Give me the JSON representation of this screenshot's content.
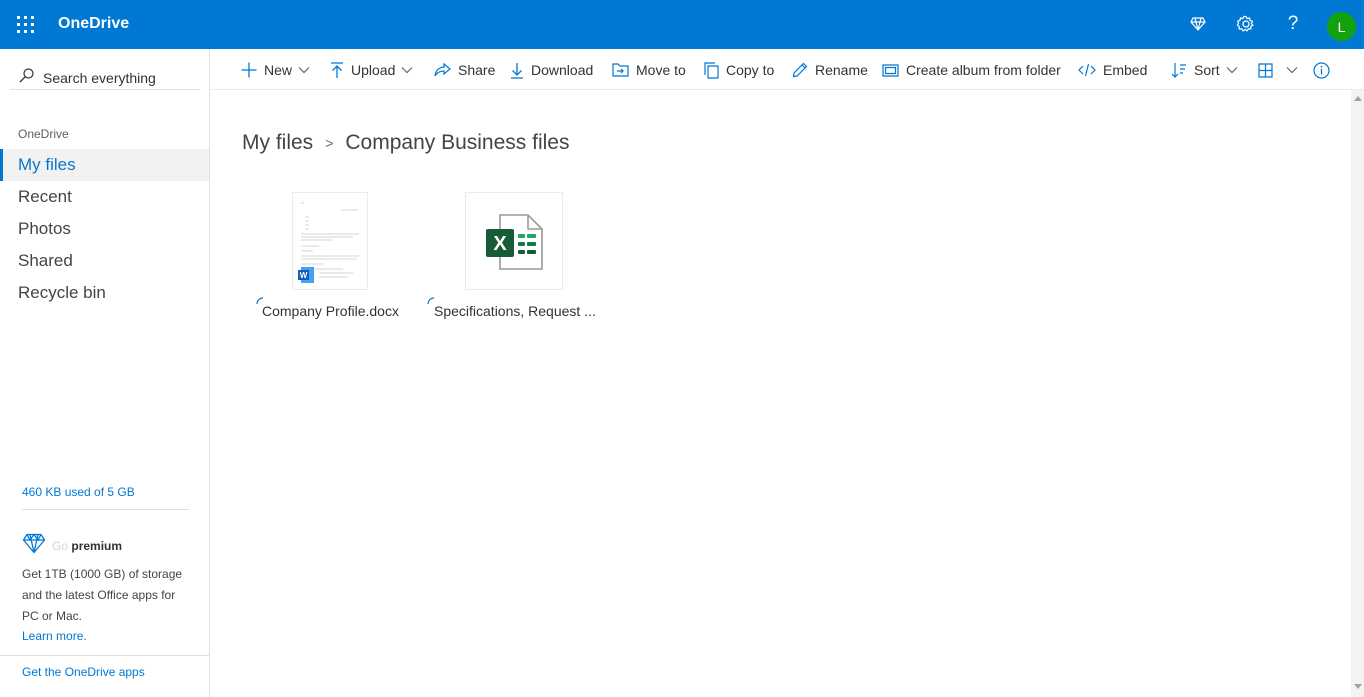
{
  "header": {
    "app_name": "OneDrive",
    "avatar_initial": "L",
    "help_label": "?"
  },
  "sidebar": {
    "search_placeholder": "Search everything",
    "section_heading": "OneDrive",
    "items": [
      {
        "label": "My files",
        "active": true
      },
      {
        "label": "Recent",
        "active": false
      },
      {
        "label": "Photos",
        "active": false
      },
      {
        "label": "Shared",
        "active": false
      },
      {
        "label": "Recycle bin",
        "active": false
      }
    ],
    "storage_text": "460 KB used of 5 GB",
    "premium": {
      "prefix": "Go",
      "title": "premium",
      "description": "Get 1TB (1000 GB) of storage and the latest Office apps for PC or Mac.",
      "learn_more": "Learn more."
    },
    "get_apps": "Get the OneDrive apps"
  },
  "toolbar": {
    "new": "New",
    "upload": "Upload",
    "share": "Share",
    "download": "Download",
    "move_to": "Move to",
    "copy_to": "Copy to",
    "rename": "Rename",
    "create_album": "Create album from folder",
    "embed": "Embed",
    "sort": "Sort"
  },
  "breadcrumb": {
    "root": "My files",
    "separator": ">",
    "current": "Company Business files"
  },
  "files": [
    {
      "name": "Company Profile.docx",
      "type": "word"
    },
    {
      "name": "Specifications, Request ...",
      "type": "excel"
    }
  ],
  "colors": {
    "brand": "#0078d4",
    "avatar": "#13a10e",
    "excel": "#185c37",
    "word": "#185abd"
  }
}
